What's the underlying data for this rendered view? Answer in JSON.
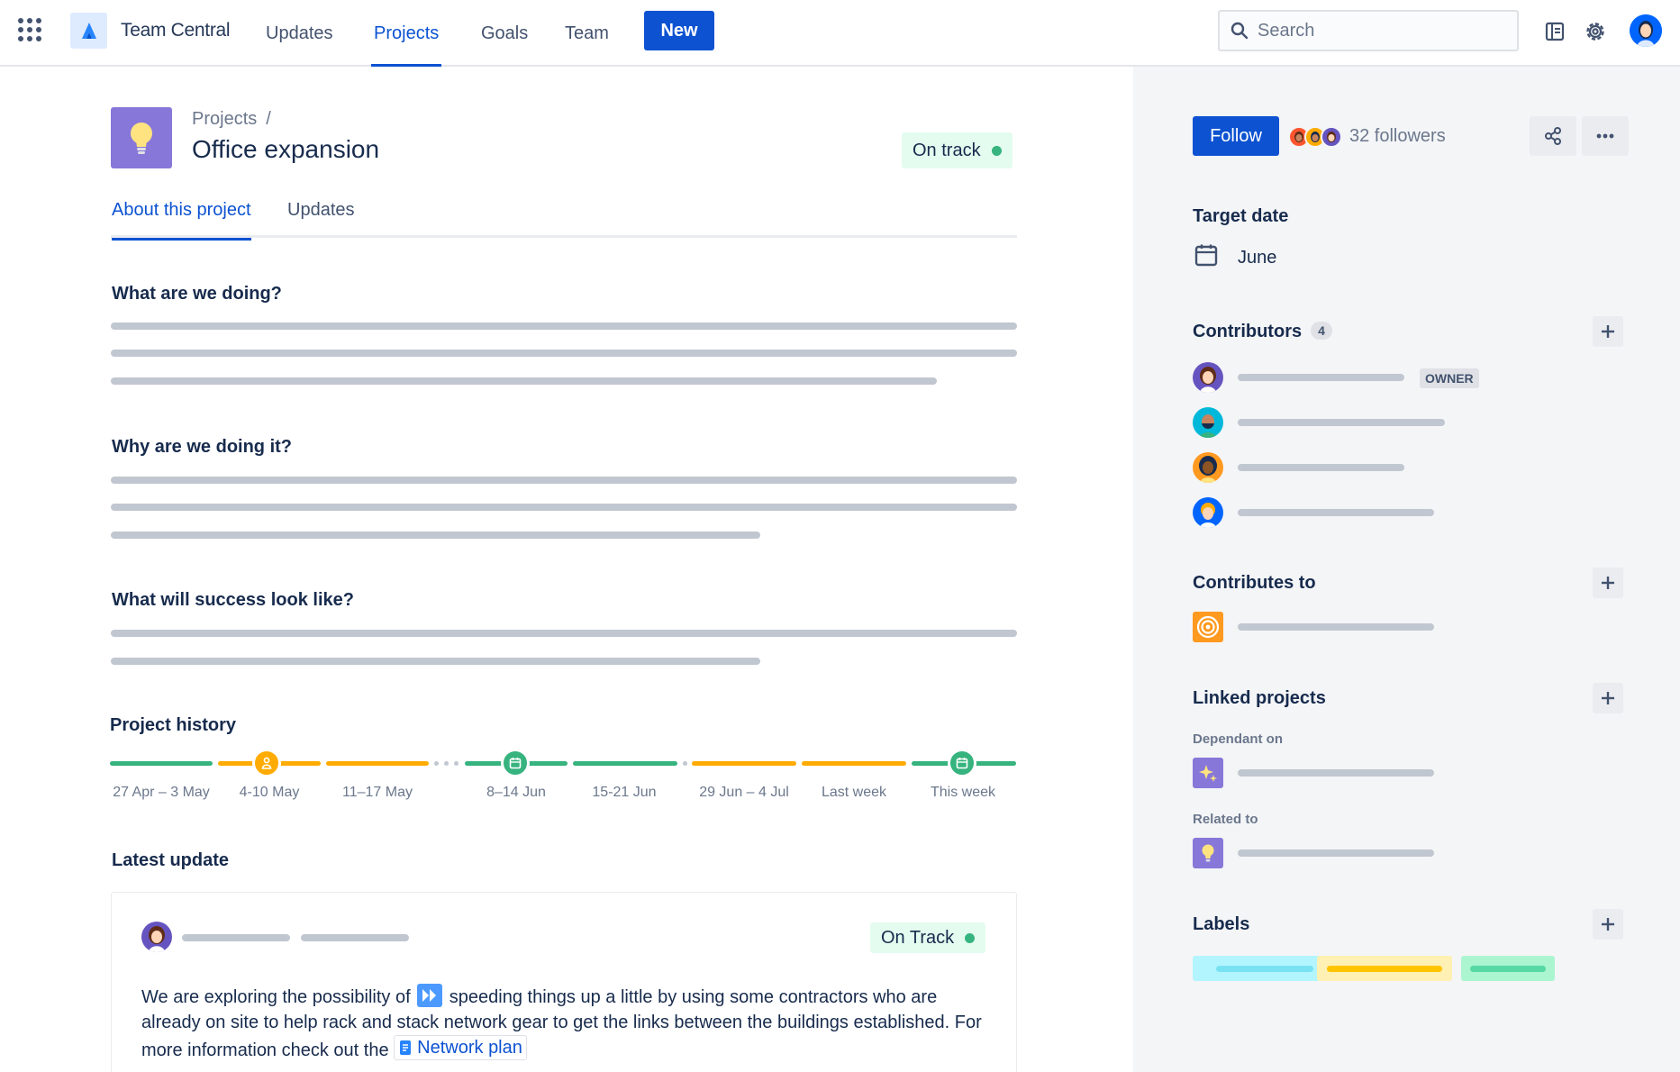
{
  "topbar": {
    "product_name": "Team Central",
    "nav": [
      "Updates",
      "Projects",
      "Goals",
      "Team"
    ],
    "active_nav": "Projects",
    "new_label": "New",
    "search_placeholder": "Search"
  },
  "project": {
    "breadcrumb": "Projects",
    "breadcrumb_sep": "/",
    "title": "Office expansion",
    "status": "On track",
    "tabs": [
      "About this project",
      "Updates"
    ],
    "sections": [
      {
        "title": "What are we doing?"
      },
      {
        "title": "Why are we doing it?"
      },
      {
        "title": "What will success look like?"
      }
    ]
  },
  "history": {
    "title": "Project history",
    "weeks": [
      "27 Apr – 3 May",
      "4-10 May",
      "11–17 May",
      "8–14 Jun",
      "15-21 Jun",
      "29 Jun – 4 Jul",
      "Last week",
      "This week"
    ],
    "colors": {
      "green": "#36B37E",
      "yellow": "#FFAB00"
    }
  },
  "latest_update": {
    "title": "Latest update",
    "status": "On Track",
    "text_before": "We are exploring the possibility of",
    "text_after": "speeding things up a little by using some contractors who are already on site to help rack and stack network gear to get the links between the buildings established. For more information check out the",
    "link_label": "Network plan"
  },
  "sidebar": {
    "follow_label": "Follow",
    "followers": "32 followers",
    "target_date_title": "Target date",
    "target_date": "June",
    "contributors_title": "Contributors",
    "contributors_count": "4",
    "owner_label": "OWNER",
    "contributes_to_title": "Contributes to",
    "linked_projects_title": "Linked projects",
    "dependant_on": "Dependant on",
    "related_to": "Related to",
    "labels_title": "Labels"
  }
}
